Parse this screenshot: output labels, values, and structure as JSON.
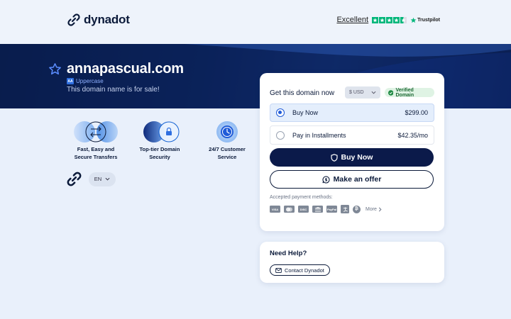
{
  "brand": {
    "name": "dynadot"
  },
  "trustpilot": {
    "rating_text": "Excellent",
    "brand": "Trustpilot",
    "stars": 4.5
  },
  "hero": {
    "domain": "annapascual.com",
    "tag": "Uppercase",
    "tag_badge": "AA",
    "subtitle": "This domain name is for sale!"
  },
  "features": [
    {
      "label_line1": "Fast, Easy and",
      "label_line2": "Secure Transfers"
    },
    {
      "label_line1": "Top-tier Domain",
      "label_line2": "Security"
    },
    {
      "label_line1": "24/7 Customer",
      "label_line2": "Service"
    }
  ],
  "language": {
    "selected": "EN"
  },
  "purchase": {
    "title": "Get this domain now",
    "currency": "$ USD",
    "verified": "Verified Domain",
    "options": [
      {
        "label": "Buy Now",
        "price": "$299.00",
        "selected": true
      },
      {
        "label": "Pay in Installments",
        "price": "$42.35/mo",
        "selected": false
      }
    ],
    "buy_button": "Buy Now",
    "offer_button": "Make an offer",
    "payment_label": "Accepted payment methods:",
    "payment_methods": [
      "VISA",
      "MC",
      "DISC",
      "BANK",
      "PayPal",
      "Alipay",
      "BTC"
    ],
    "more_label": "More"
  },
  "help": {
    "title": "Need Help?",
    "contact_button": "Contact Dynadot"
  },
  "colors": {
    "navy": "#0b1a4a",
    "accent": "#1f5bd8",
    "verified_green": "#1f6a36",
    "trustpilot_green": "#00b67a"
  }
}
